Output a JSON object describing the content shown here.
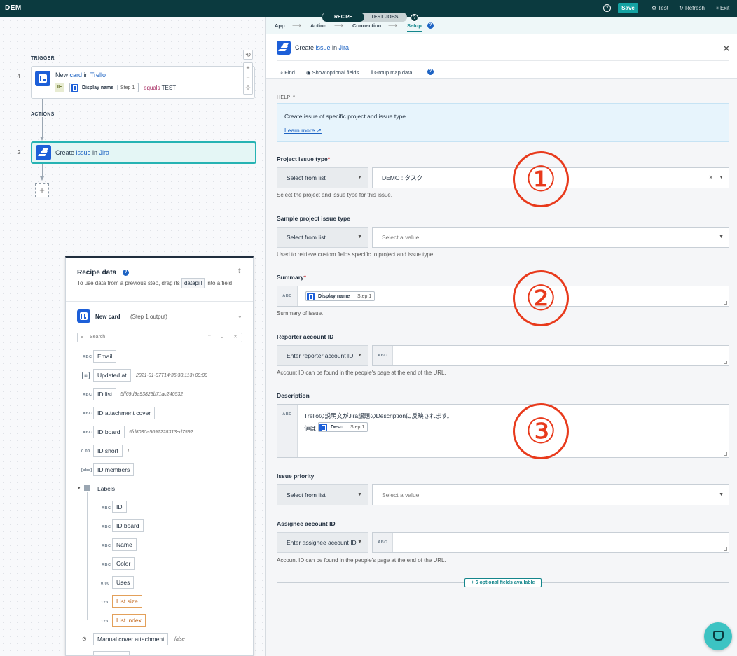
{
  "topbar": {
    "logo": "DEM",
    "modes": [
      "RECIPE",
      "TEST JOBS"
    ],
    "help": "?",
    "save": "Save",
    "test": "Test",
    "refresh": "Refresh",
    "exit": "Exit"
  },
  "canvas": {
    "trigger_label": "TRIGGER",
    "actions_label": "ACTIONS",
    "step1": {
      "num": "1",
      "prefix": "New ",
      "obj": "card",
      "mid": " in ",
      "app": "Trello",
      "if": "IF",
      "pill_name": "Display name",
      "pill_step": "Step 1",
      "op": "equals",
      "value": "TEST"
    },
    "step2": {
      "num": "2",
      "prefix": "Create ",
      "obj": "issue",
      "mid": " in ",
      "app": "Jira"
    },
    "zoom": {
      "reset": "⟲",
      "in": "+",
      "out": "−",
      "fit": "⊹"
    },
    "add": "+"
  },
  "recipe_data": {
    "title": "Recipe data",
    "help": "?",
    "desc_a": "To use data from a previous step, drag its",
    "desc_chip": "datapill",
    "desc_b": "into a field",
    "card_title": "New card",
    "card_sub": "(Step 1 output)",
    "search_placeholder": "Search",
    "fields": [
      {
        "type": "ABC",
        "name": "Email",
        "sample": ""
      },
      {
        "type": "CAL",
        "name": "Updated at",
        "sample": "2021-01-07T14:35:38.113+09:00"
      },
      {
        "type": "ABC",
        "name": "ID list",
        "sample": "5ff69d9a93823b71ac240532"
      },
      {
        "type": "ABC",
        "name": "ID attachment cover",
        "sample": ""
      },
      {
        "type": "ABC",
        "name": "ID board",
        "sample": "5fd8030a5691228313ed7592"
      },
      {
        "type": "0.00",
        "name": "ID short",
        "sample": "1"
      },
      {
        "type": "[abc]",
        "name": "ID members",
        "sample": ""
      }
    ],
    "labels_group": "Labels",
    "label_fields": [
      {
        "type": "ABC",
        "name": "ID"
      },
      {
        "type": "ABC",
        "name": "ID board"
      },
      {
        "type": "ABC",
        "name": "Name"
      },
      {
        "type": "ABC",
        "name": "Color"
      },
      {
        "type": "0.00",
        "name": "Uses"
      },
      {
        "type": "123",
        "name": "List size"
      },
      {
        "type": "123",
        "name": "List index"
      }
    ],
    "bool_field": {
      "name": "Manual cover attachment",
      "sample": "false"
    }
  },
  "setup": {
    "crumbs": [
      "App",
      "Action",
      "Connection",
      "Setup"
    ],
    "crumb_help": "?",
    "title_prefix": "Create ",
    "title_obj": "issue",
    "title_mid": " in ",
    "title_app": "Jira",
    "close": "✕",
    "toolbar": {
      "find": "Find",
      "optional": "Show optional fields",
      "group": "Group map data",
      "help": "?"
    },
    "help_label": "HELP",
    "help_text": "Create issue of specific project and issue type.",
    "learn_more": "Learn more",
    "fields": {
      "project_issue_type": {
        "label": "Project issue type",
        "req": "*",
        "mode": "Select from list",
        "value": "DEMO : タスク",
        "hint": "Select the project and issue type for this issue."
      },
      "sample_project": {
        "label": "Sample project issue type",
        "mode": "Select from list",
        "placeholder": "Select a value",
        "hint": "Used to retrieve custom fields specific to project and issue type."
      },
      "summary": {
        "label": "Summary",
        "req": "*",
        "type": "ABC",
        "pill_name": "Display name",
        "pill_step": "Step 1",
        "hint": "Summary of issue."
      },
      "reporter": {
        "label": "Reporter account ID",
        "mode": "Enter reporter account ID",
        "type": "ABC",
        "hint": "Account ID can be found in the people's page at the end of the URL."
      },
      "description": {
        "label": "Description",
        "type": "ABC",
        "line1": "Trelloの説明文がJira課題のDescriptionに反映されます。",
        "line2": "値は",
        "pill_name": "Desc",
        "pill_step": "Step 1"
      },
      "priority": {
        "label": "Issue priority",
        "mode": "Select from list",
        "placeholder": "Select a value"
      },
      "assignee": {
        "label": "Assignee account ID",
        "mode": "Enter assignee account ID",
        "type": "ABC",
        "hint": "Account ID can be found in the people's page at the end of the URL."
      }
    },
    "optional_btn": "+ 6 optional fields available"
  },
  "annotations": [
    "①",
    "②",
    "③"
  ],
  "colors": {
    "topbar": "#0b3a3f",
    "accent": "#14a3a3",
    "annotation": "#e83a1c",
    "trello": "#1d5fd8"
  }
}
